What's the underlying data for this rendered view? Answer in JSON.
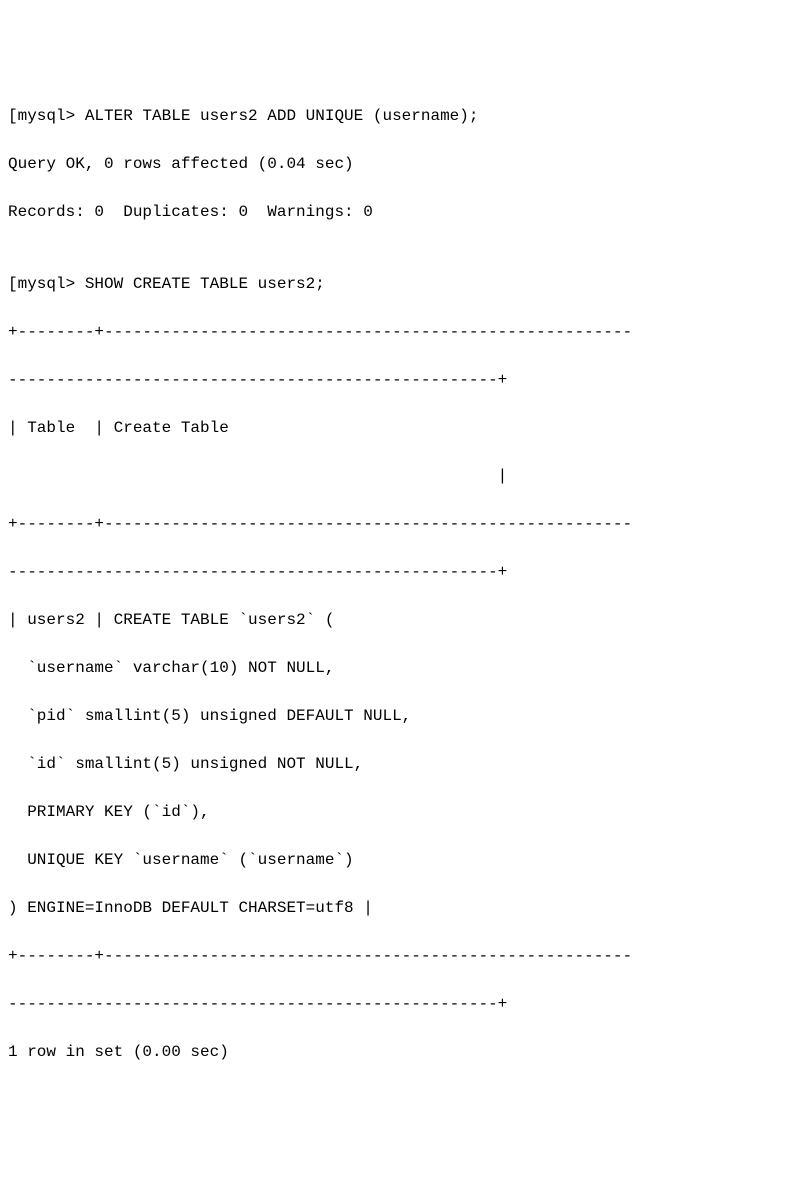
{
  "terminal": {
    "prompt1": "[mysql> ",
    "cmd1": "ALTER TABLE users2 ADD UNIQUE (username);",
    "result1_line1": "Query OK, 0 rows affected (0.04 sec)",
    "result1_line2": "Records: 0  Duplicates: 0  Warnings: 0",
    "blank": "",
    "prompt2": "[mysql> ",
    "cmd2": "SHOW CREATE TABLE users2;",
    "sep1": "+--------+-------------------------------------------------------",
    "sep1b": "---------------------------------------------------+",
    "header": "| Table  | Create Table",
    "header2": "                                                   |",
    "sep2": "+--------+-------------------------------------------------------",
    "sep2b": "---------------------------------------------------+",
    "row1": "| users2 | CREATE TABLE `users2` (",
    "row2": "  `username` varchar(10) NOT NULL,",
    "row3": "  `pid` smallint(5) unsigned DEFAULT NULL,",
    "row4": "  `id` smallint(5) unsigned NOT NULL,",
    "row5": "  PRIMARY KEY (`id`),",
    "row6": "  UNIQUE KEY `username` (`username`)",
    "row7": ") ENGINE=InnoDB DEFAULT CHARSET=utf8 |",
    "sep3": "+--------+-------------------------------------------------------",
    "sep3b": "---------------------------------------------------+",
    "footer": "1 row in set (0.00 sec)"
  }
}
